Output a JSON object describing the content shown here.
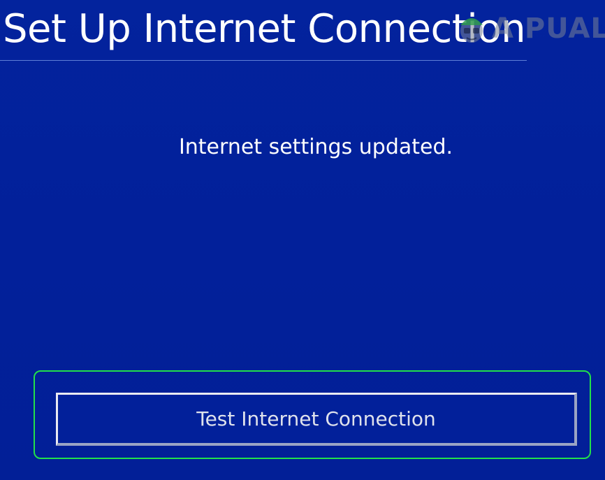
{
  "header": {
    "title": "Set Up Internet Connection"
  },
  "watermark": {
    "text": "A  PUALS",
    "icon": "appuals-mascot-icon"
  },
  "main": {
    "message": "Internet settings updated."
  },
  "actions": {
    "test_button_label": "Test Internet Connection"
  },
  "colors": {
    "background": "#02209a",
    "focus": "#22e04a",
    "text": "#ffffff"
  }
}
